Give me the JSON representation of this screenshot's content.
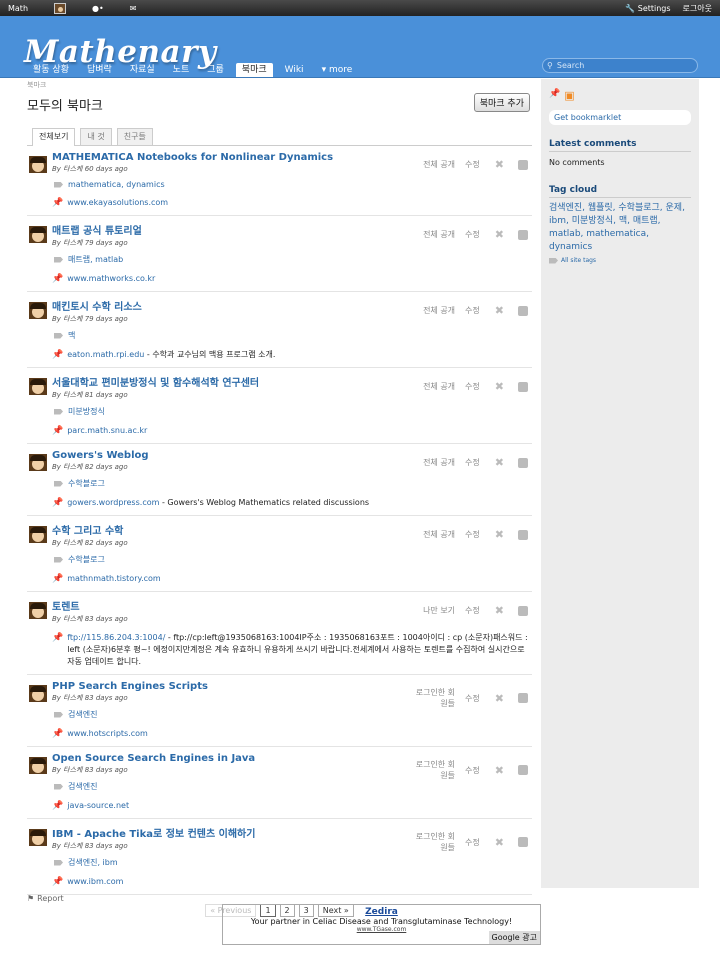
{
  "topbar": {
    "app": "Math",
    "settings": "Settings",
    "logout": "로그아웃"
  },
  "header": {
    "logo": "Mathenary",
    "tabs": [
      "활동 상황",
      "답벼락",
      "자료실",
      "노트",
      "그룹",
      "북마크",
      "Wiki",
      "▾ more"
    ],
    "search_placeholder": "Search"
  },
  "page": {
    "breadcrumb": "북마크",
    "title": "모두의 북마크",
    "add_button": "북마크 추가",
    "subtabs": [
      "전체보기",
      "내 것",
      "친구들"
    ]
  },
  "entries": [
    {
      "title": "MATHEMATICA Notebooks for Nonlinear Dynamics",
      "by": "By 타스케 60 days ago",
      "tags": "mathematica, dynamics",
      "link": "www.ekayasolutions.com",
      "desc": "",
      "visibility": "전체 공개",
      "edit": "수정"
    },
    {
      "title": "매트랩 공식 튜토리얼",
      "by": "By 타스케 79 days ago",
      "tags": "매트랩, matlab",
      "link": "www.mathworks.co.kr",
      "desc": "",
      "visibility": "전체 공개",
      "edit": "수정"
    },
    {
      "title": "매킨토시 수학 리소스",
      "by": "By 타스케 79 days ago",
      "tags": "맥",
      "link": "eaton.math.rpi.edu",
      "desc": " - 수학과 교수님의 맥용 프로그램 소개.",
      "visibility": "전체 공개",
      "edit": "수정"
    },
    {
      "title": "서울대학교 편미분방정식 및 함수해석학 연구센터",
      "by": "By 타스케 81 days ago",
      "tags": "미분방정식",
      "link": "parc.math.snu.ac.kr",
      "desc": "",
      "visibility": "전체 공개",
      "edit": "수정"
    },
    {
      "title": "Gowers's Weblog",
      "by": "By 타스케 82 days ago",
      "tags": "수학블로그",
      "link": "gowers.wordpress.com",
      "desc": " - Gowers's Weblog Mathematics related discussions",
      "visibility": "전체 공개",
      "edit": "수정"
    },
    {
      "title": "수학 그리고 수학",
      "by": "By 타스케 82 days ago",
      "tags": "수학블로그",
      "link": "mathnmath.tistory.com",
      "desc": "",
      "visibility": "전체 공개",
      "edit": "수정"
    },
    {
      "title": "토렌트",
      "by": "By 타스케 83 days ago",
      "tags": "",
      "link": "ftp://115.86.204.3:1004/",
      "desc": " - ftp://cp:left@1935068163:1004IP주소 : 1935068163포트 : 1004아이디 : cp (소문자)패스워드 : left (소문자)6분후 평~! 에정이지만계정은 계속 유효하니 유용하게 쓰시기 바랍니다.전세계에서 사용하는 토렌트를 수집하여 실시간으로 자동 업데이트 합니다.",
      "visibility": "나만 보기",
      "edit": "수정"
    },
    {
      "title": "PHP Search Engines Scripts",
      "by": "By 타스케 83 days ago",
      "tags": "검색엔진",
      "link": "www.hotscripts.com",
      "desc": "",
      "visibility": "로그인한 회원들",
      "edit": "수정"
    },
    {
      "title": "Open Source Search Engines in Java",
      "by": "By 타스케 83 days ago",
      "tags": "검색엔진",
      "link": "java-source.net",
      "desc": "",
      "visibility": "로그인한 회원들",
      "edit": "수정"
    },
    {
      "title": "IBM - Apache Tika로 정보 컨텐츠 이해하기",
      "by": "By 타스케 83 days ago",
      "tags": "검색엔진, ibm",
      "link": "www.ibm.com",
      "desc": "",
      "visibility": "로그인한 회원들",
      "edit": "수정"
    }
  ],
  "pager": {
    "prev": "« Previous",
    "pages": [
      "1",
      "2",
      "3"
    ],
    "next": "Next »"
  },
  "sidebar": {
    "bookmarklet": "Get bookmarklet",
    "comments_title": "Latest comments",
    "comments_text": "No comments",
    "tagcloud_title": "Tag cloud",
    "tags": "검색엔진, 웹플릿, 수학블로그, 운제, ibm, 미분방정식, 맥, 매트랩, matlab, mathematica, dynamics",
    "all_tags": "All site tags"
  },
  "footer": {
    "report": "Report",
    "ad_title": "Zedira",
    "ad_text": "Your partner in Celiac Disease and Transglutaminase Technology!",
    "ad_url": "www.TGase.com",
    "ad_google": "Google 광고"
  }
}
